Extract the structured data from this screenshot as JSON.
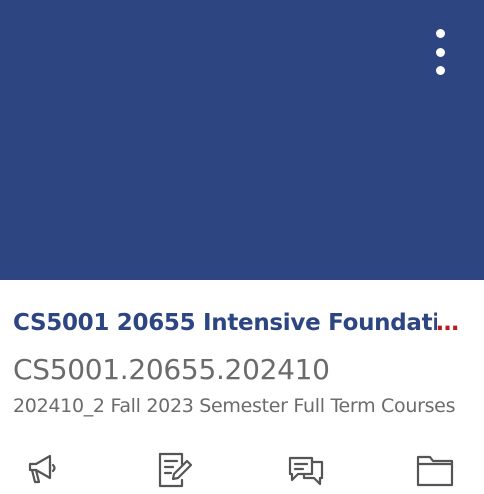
{
  "course_card": {
    "hero_color": "#2d4580",
    "menu_icon": "kebab-menu-icon",
    "title": "CS5001 20655 Intensive Foundati",
    "title_overflow": "…",
    "course_code": "CS5001.20655.202410",
    "term": "202410_2 Fall 2023 Semester Full Term Courses",
    "actions": [
      {
        "icon": "announcements-icon"
      },
      {
        "icon": "assignments-icon"
      },
      {
        "icon": "discussions-icon"
      },
      {
        "icon": "files-icon"
      }
    ]
  }
}
